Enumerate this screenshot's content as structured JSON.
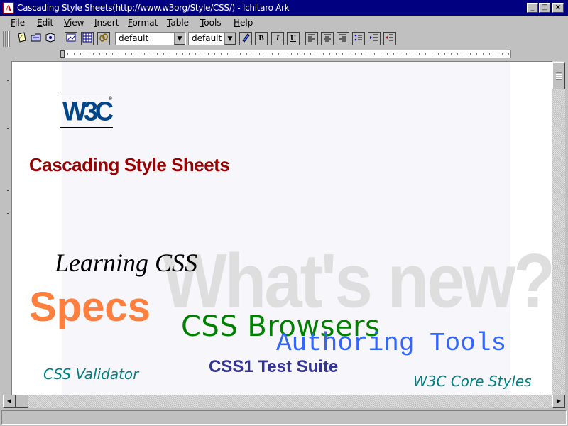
{
  "window": {
    "title": "Cascading Style Sheets(http://www.w3org/Style/CSS/) - Ichitaro Ark",
    "app_icon_letter": "A",
    "minimize_glyph": "_",
    "maximize_glyph": "□",
    "close_glyph": "×"
  },
  "menu": [
    {
      "label": "File",
      "mnemonic": "F",
      "rest": "ile"
    },
    {
      "label": "Edit",
      "mnemonic": "E",
      "rest": "dit"
    },
    {
      "label": "View",
      "mnemonic": "V",
      "rest": "iew"
    },
    {
      "label": "Insert",
      "mnemonic": "I",
      "rest": "nsert"
    },
    {
      "label": "Format",
      "mnemonic": "F",
      "rest": "ormat"
    },
    {
      "label": "Table",
      "mnemonic": "T",
      "rest": "able"
    },
    {
      "label": "Tools",
      "mnemonic": "T",
      "rest": "ools"
    },
    {
      "label": "Help",
      "mnemonic": "H",
      "rest": "elp"
    }
  ],
  "toolbar": {
    "font_select": "default",
    "size_select": "default",
    "bold": "B",
    "italic": "I",
    "underline": "U",
    "icons": [
      "new-document-icon",
      "open-folder-icon",
      "save-icon",
      "image-icon",
      "table-icon",
      "link-icon",
      "pen-color-icon",
      "align-left-icon",
      "align-center-icon",
      "align-right-icon",
      "bullet-list-icon",
      "indent-icon",
      "outdent-icon"
    ]
  },
  "document": {
    "logo": "W3C",
    "logo_mark": "®",
    "heading": "Cascading Style Sheets",
    "watermark": "What's new?",
    "links": {
      "learning_css": "Learning CSS",
      "specs": "Specs",
      "css_browsers": "CSS Browsers",
      "authoring_tools": "Authoring Tools",
      "css_validator": "CSS Validator",
      "css1_test_suite": "CSS1 Test Suite",
      "w3c_core_styles": "W3C Core Styles"
    },
    "colors": {
      "heading": "#990000",
      "specs": "#ff7f3f",
      "css_browsers": "#008000",
      "authoring_tools": "#3366ff",
      "css_validator": "#008080",
      "css1_test_suite": "#333399",
      "watermark": "#dedede"
    }
  },
  "scrollbars": {
    "up_glyph": "▲",
    "left_glyph": "◀",
    "right_glyph": "▶"
  }
}
